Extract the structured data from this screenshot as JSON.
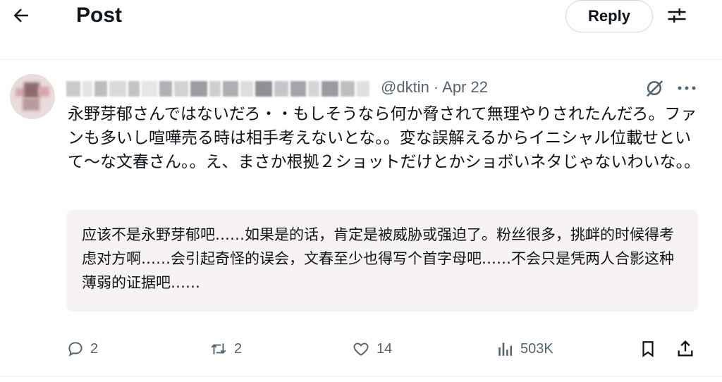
{
  "header": {
    "title": "Post",
    "reply_label": "Reply",
    "back_icon": "arrow-left-icon",
    "filter_icon": "sliders-icon"
  },
  "post": {
    "handle": "@dktin",
    "separator": " · ",
    "date": "Apr 22",
    "text": "永野芽郁さんではないだろ・・もしそうなら何か脅されて無理やりされたんだろ。ファンも多いし喧嘩売る時は相手考えないとな。。変な誤解えるからイニシャル位載せといて〜な文春さん。。え、まさか根拠２ショットだけとかショボいネタじゃないわいな。。",
    "translation": "应该不是永野芽郁吧……如果是的话，肯定是被威胁或强迫了。粉丝很多，挑衅的时候得考虑对方啊……会引起奇怪的误会，文春至少也得写个首字母吧……不会只是凭两人合影这种薄弱的证据吧……"
  },
  "actions": {
    "replies": "2",
    "reposts": "2",
    "likes": "14",
    "views": "503K"
  },
  "colors": {
    "secondary_text": "#536471",
    "translation_bg": "#f7f3f3",
    "border": "#eff3f4"
  }
}
